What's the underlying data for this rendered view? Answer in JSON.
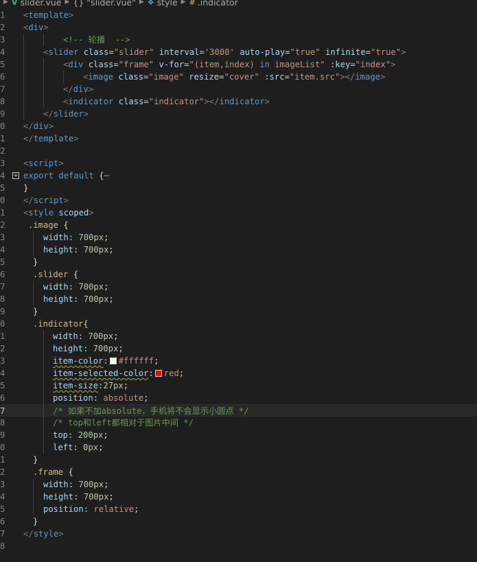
{
  "breadcrumb": {
    "items": [
      "slider.vue",
      "{} \"slider.vue\"",
      "style",
      ".indicator"
    ]
  },
  "colors": {
    "white_swatch": "#ffffff",
    "red_swatch": "#ff0000"
  },
  "line_numbers": [
    "1",
    "2",
    "3",
    "4",
    "5",
    "6",
    "7",
    "8",
    "9",
    "0",
    "1",
    "2",
    "3",
    "4",
    "5",
    "0",
    "1",
    "2",
    "3",
    "4",
    "5",
    "6",
    "7",
    "8",
    "9",
    "0",
    "1",
    "2",
    "3",
    "4",
    "5",
    "6",
    "7",
    "8",
    "9",
    "0",
    "1",
    "2",
    "3",
    "4",
    "5",
    "6",
    "7",
    "8"
  ],
  "code": {
    "l1": {
      "open": "<",
      "tag": "template",
      "close": ">"
    },
    "l2": {
      "open": "<",
      "tag": "div",
      "close": ">"
    },
    "l3": {
      "comment": "<!-- 轮播  -->"
    },
    "l4": {
      "open": "<",
      "tag": "slider",
      "a1": "class",
      "v1": "\"slider\"",
      "a2": "interval",
      "v2": "'3000'",
      "a3": "auto-play",
      "v3": "\"true\"",
      "a4": "infinite",
      "v4": "\"true\"",
      "close": ">"
    },
    "l5": {
      "open": "<",
      "tag": "div",
      "a1": "class",
      "v1": "\"frame\"",
      "a2": "v-for",
      "v2a": "\"(item,index) ",
      "v2b": "in",
      "v2c": " imageList\"",
      "a3": ":key",
      "v3": "\"index\"",
      "close": ">"
    },
    "l6": {
      "open": "<",
      "tag": "image",
      "a1": "class",
      "v1": "\"image\"",
      "a2": "resize",
      "v2": "\"cover\"",
      "a3": ":src",
      "v3": "\"item.src\"",
      "close": "></",
      "tag2": "image",
      "close2": ">"
    },
    "l7": {
      "open": "</",
      "tag": "div",
      "close": ">"
    },
    "l8": {
      "open": "<",
      "tag": "indicator",
      "a1": "class",
      "v1": "\"indicator\"",
      "close": "></",
      "tag2": "indicator",
      "close2": ">"
    },
    "l9": {
      "open": "</",
      "tag": "slider",
      "close": ">"
    },
    "l10": {
      "open": "</",
      "tag": "div",
      "close": ">"
    },
    "l11": {
      "open": "</",
      "tag": "template",
      "close": ">"
    },
    "l13": {
      "open": "<",
      "tag": "script",
      "close": ">"
    },
    "l14": {
      "kw1": "export",
      "kw2": "default",
      "brace": "{",
      "ellipsis": "⋯"
    },
    "l15": {
      "brace": "}"
    },
    "l16": {
      "open": "</",
      "tag": "script",
      "close": ">"
    },
    "l17": {
      "open": "<",
      "tag": "style",
      "attr": "scoped",
      "close": ">"
    },
    "l18": {
      "sel": ".image",
      "brace": "{"
    },
    "l19": {
      "prop": "width",
      "num": "700px"
    },
    "l20": {
      "prop": "height",
      "num": "700px"
    },
    "l21": {
      "brace": "}"
    },
    "l22": {
      "sel": ".slider",
      "brace": "{"
    },
    "l23": {
      "prop": "width",
      "num": "700px"
    },
    "l24": {
      "prop": "height",
      "num": "700px"
    },
    "l25": {
      "brace": "}"
    },
    "l26": {
      "sel": ".indicator",
      "brace": "{"
    },
    "l27": {
      "prop": "width",
      "num": "700px"
    },
    "l28": {
      "prop": "height",
      "num": "700px"
    },
    "l29": {
      "prop": "item-color",
      "val": "#ffffff"
    },
    "l30": {
      "prop": "item-selected-color",
      "val": "red"
    },
    "l31": {
      "prop": "item-size",
      "num": "27px"
    },
    "l32": {
      "prop": "position",
      "val": "absolute"
    },
    "l33": {
      "comment": "/* 如果不加absolute，手机将不会显示小圆点 */"
    },
    "l34": {
      "comment": "/* top和left都相对于图片中间 */"
    },
    "l35": {
      "prop": "top",
      "num": "200px"
    },
    "l36": {
      "prop": "left",
      "num": "0px"
    },
    "l37": {
      "brace": "}"
    },
    "l38": {
      "sel": ".frame",
      "brace": "{"
    },
    "l39": {
      "prop": "width",
      "num": "700px"
    },
    "l40": {
      "prop": "height",
      "num": "700px"
    },
    "l41": {
      "prop": "position",
      "val": "relative"
    },
    "l42": {
      "brace": "}"
    },
    "l43": {
      "open": "</",
      "tag": "style",
      "close": ">"
    }
  }
}
